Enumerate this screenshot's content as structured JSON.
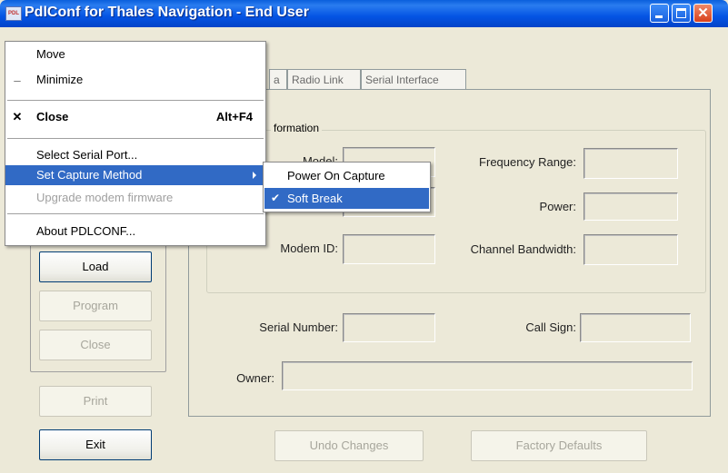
{
  "window": {
    "title": "PdlConf for Thales Navigation - End User",
    "app_icon_text": "PDL"
  },
  "tabs": [
    "a",
    "Radio Link",
    "Serial Interface"
  ],
  "group": {
    "title": "formation",
    "labels": {
      "model": "Model:",
      "modem_id": "Modem ID:",
      "frequency_range": "Frequency Range:",
      "power": "Power:",
      "channel_bandwidth": "Channel Bandwidth:"
    }
  },
  "lower": {
    "serial_number": "Serial Number:",
    "call_sign": "Call Sign:",
    "owner": "Owner:"
  },
  "buttons": {
    "load": "Load",
    "program": "Program",
    "close": "Close",
    "print": "Print",
    "exit": "Exit",
    "undo": "Undo Changes",
    "factory": "Factory Defaults"
  },
  "system_menu": {
    "move": "Move",
    "minimize": "Minimize",
    "close": "Close",
    "close_shortcut": "Alt+F4",
    "select_serial_port": "Select Serial Port...",
    "set_capture_method": "Set Capture Method",
    "upgrade_firmware": "Upgrade modem firmware",
    "about": "About PDLCONF..."
  },
  "capture_submenu": {
    "power_on_capture": "Power On Capture",
    "soft_break": "Soft Break",
    "checked_item": "Soft Break"
  }
}
